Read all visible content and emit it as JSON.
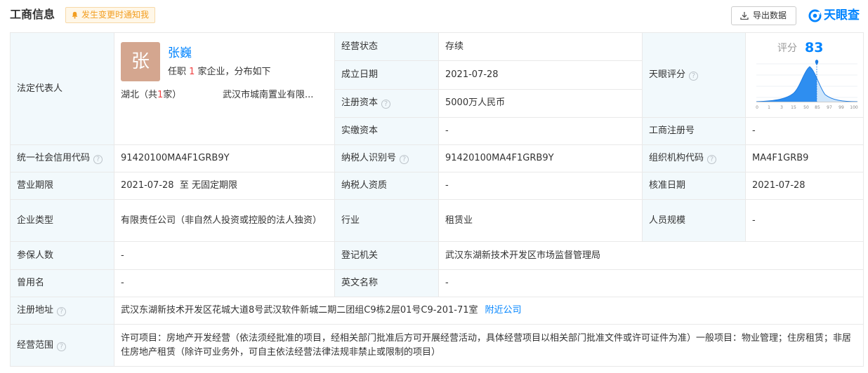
{
  "header": {
    "title": "工商信息",
    "notify_label": "发生变更时通知我",
    "export_label": "导出数据",
    "brand": "天眼查",
    "accent": "#0084ff"
  },
  "legal_rep": {
    "label": "法定代表人",
    "avatar_char": "张",
    "name": "张巍",
    "desc_prefix": "任职 ",
    "count": "1",
    "desc_suffix": " 家企业，分布如下",
    "region_prefix": "湖北（共",
    "region_count": "1",
    "region_suffix": "家）",
    "company": "武汉市城南置业有限..."
  },
  "score": {
    "label": "天眼评分",
    "caption": "评分",
    "value": "83",
    "ticks": [
      "0",
      "1",
      "3",
      "15",
      "50",
      "85",
      "97",
      "99",
      "100"
    ]
  },
  "fields": {
    "status_label": "经营状态",
    "status_value": "存续",
    "founded_label": "成立日期",
    "founded_value": "2021-07-28",
    "capital_label": "注册资本",
    "capital_value": "5000万人民币",
    "paid_capital_label": "实缴资本",
    "paid_capital_value": "-",
    "reg_no_label": "工商注册号",
    "reg_no_value": "-",
    "credit_code_label": "统一社会信用代码",
    "credit_code_value": "91420100MA4F1GRB9Y",
    "taxpayer_id_label": "纳税人识别号",
    "taxpayer_id_value": "91420100MA4F1GRB9Y",
    "org_code_label": "组织机构代码",
    "org_code_value": "MA4F1GRB9",
    "term_label": "营业期限",
    "term_value": "2021-07-28  至 无固定期限",
    "taxpayer_quality_label": "纳税人资质",
    "taxpayer_quality_value": "-",
    "approve_date_label": "核准日期",
    "approve_date_value": "2021-07-28",
    "type_label": "企业类型",
    "type_value": "有限责任公司（非自然人投资或控股的法人独资）",
    "industry_label": "行业",
    "industry_value": "租赁业",
    "staff_size_label": "人员规模",
    "staff_size_value": "-",
    "insured_label": "参保人数",
    "insured_value": "-",
    "authority_label": "登记机关",
    "authority_value": "武汉东湖新技术开发区市场监督管理局",
    "former_name_label": "曾用名",
    "former_name_value": "-",
    "english_name_label": "英文名称",
    "english_name_value": "-",
    "address_label": "注册地址",
    "address_value": "武汉东湖新技术开发区花城大道8号武汉软件新城二期二团组C9栋2层01号C9-201-71室",
    "nearby_label": "附近公司",
    "scope_label": "经营范围",
    "scope_value": "许可项目：房地产开发经营（依法须经批准的项目，经相关部门批准后方可开展经营活动，具体经营项目以相关部门批准文件或许可证件为准）一般项目：物业管理；住房租赁；非居住房地产租赁（除许可业务外，可自主依法经营法律法规非禁止或限制的项目）"
  }
}
